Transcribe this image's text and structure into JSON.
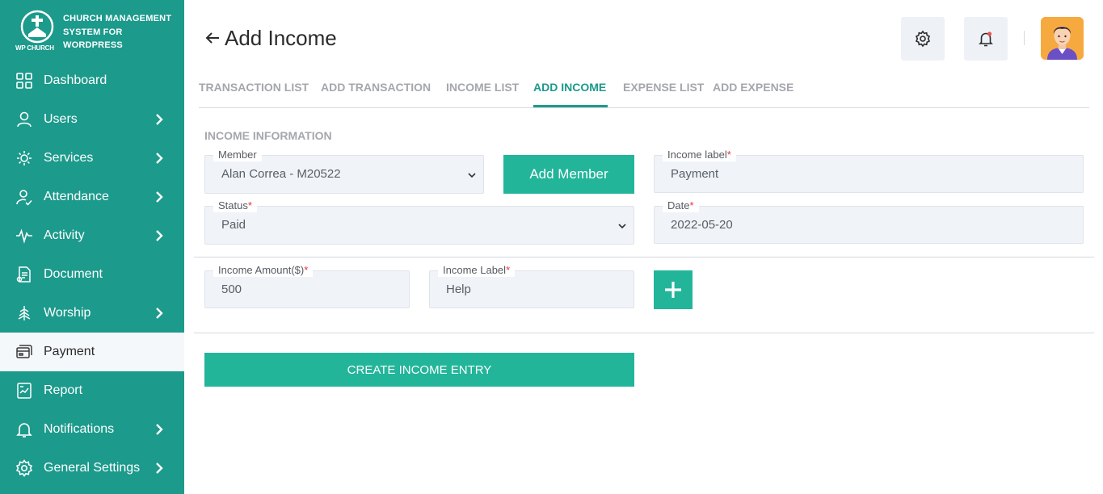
{
  "brand": {
    "title": "CHURCH MANAGEMENT SYSTEM FOR WORDPRESS",
    "logo_text": "WP CHURCH"
  },
  "sidebar": {
    "items": [
      {
        "label": "Dashboard",
        "icon": "grid-icon"
      },
      {
        "label": "Users",
        "icon": "user-icon"
      },
      {
        "label": "Services",
        "icon": "services-icon"
      },
      {
        "label": "Attendance",
        "icon": "attendance-icon"
      },
      {
        "label": "Activity",
        "icon": "activity-icon"
      },
      {
        "label": "Document",
        "icon": "document-icon"
      },
      {
        "label": "Worship",
        "icon": "worship-icon"
      },
      {
        "label": "Payment",
        "icon": "payment-icon"
      },
      {
        "label": "Report",
        "icon": "report-icon"
      },
      {
        "label": "Notifications",
        "icon": "bell-icon"
      },
      {
        "label": "General Settings",
        "icon": "gear-icon"
      }
    ]
  },
  "header": {
    "title": "Add Income"
  },
  "tabs": [
    {
      "label": "TRANSACTION LIST"
    },
    {
      "label": "ADD TRANSACTION"
    },
    {
      "label": "INCOME LIST"
    },
    {
      "label": "ADD INCOME"
    },
    {
      "label": "EXPENSE LIST"
    },
    {
      "label": "ADD EXPENSE"
    }
  ],
  "form": {
    "section_title": "INCOME INFORMATION",
    "member": {
      "label": "Member",
      "value": "Alan Correa - M20522"
    },
    "add_member_label": "Add Member",
    "income_label": {
      "label": "Income label",
      "value": "Payment"
    },
    "status": {
      "label": "Status",
      "value": "Paid"
    },
    "date": {
      "label": "Date",
      "value": "2022-05-20"
    },
    "income_amount": {
      "label": "Income Amount($)",
      "value": "500"
    },
    "income_item_label": {
      "label": "Income Label",
      "value": "Help"
    },
    "add_row_label": "+",
    "submit_label": "CREATE INCOME ENTRY",
    "required_mark": "*"
  },
  "colors": {
    "brand": "#1c9a8c",
    "button": "#22b59a",
    "required": "#e0343a",
    "notification_dot": "#e8544f"
  }
}
